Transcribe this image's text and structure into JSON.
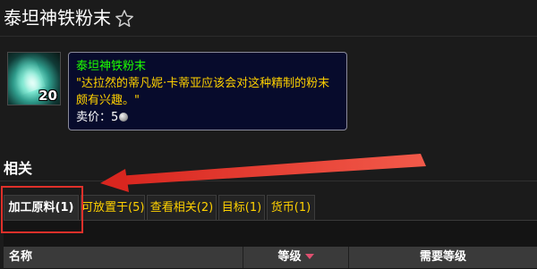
{
  "page": {
    "title": "泰坦神铁粉末"
  },
  "item": {
    "stack_count": "20",
    "tooltip": {
      "name": "泰坦神铁粉末",
      "description": "\"达拉然的蒂凡妮·卡蒂亚应该会对这种精制的粉末颇有兴趣。\"",
      "price_label": "卖价：5",
      "price_icon": "silver-coin-icon"
    },
    "colors": {
      "name": "#1eff00",
      "description": "#ffd100",
      "tooltip_bg": "#070b2c"
    }
  },
  "related": {
    "heading": "相关",
    "tabs": [
      {
        "label": "加工原料(1)",
        "active": true
      },
      {
        "label": "可放置于(5)",
        "active": false
      },
      {
        "label": "查看相关(2)",
        "active": false
      },
      {
        "label": "目标(1)",
        "active": false
      },
      {
        "label": "货币(1)",
        "active": false
      }
    ],
    "table": {
      "columns": [
        "名称",
        "等级",
        "需要等级"
      ],
      "sorted_column": "等级"
    }
  },
  "annotation": {
    "highlight_color": "#e0302a"
  }
}
